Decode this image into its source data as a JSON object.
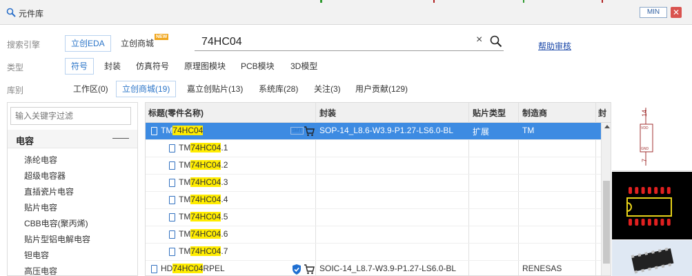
{
  "window": {
    "title": "元件库",
    "min_label": "MIN",
    "close_label": "✕"
  },
  "search_row": {
    "label": "搜索引擎",
    "engines": [
      "立创EDA",
      "立创商城"
    ],
    "new_badge": "NEW",
    "query": "74HC04",
    "help_link": "帮助审核"
  },
  "type_row": {
    "label": "类型",
    "types": [
      "符号",
      "封装",
      "仿真符号",
      "原理图模块",
      "PCB模块",
      "3D模型"
    ]
  },
  "lib_row": {
    "label": "库别",
    "libs": [
      "工作区(0)",
      "立创商城(19)",
      "嘉立创贴片(13)",
      "系统库(28)",
      "关注(3)",
      "用户贡献(129)"
    ]
  },
  "left_panel": {
    "filter_placeholder": "输入关键字过滤",
    "category": "电容",
    "items": [
      "涤纶电容",
      "超级电容器",
      "直插瓷片电容",
      "贴片电容",
      "CBB电容(聚丙烯)",
      "贴片型铝电解电容",
      "钽电容",
      "高压电容"
    ]
  },
  "table": {
    "headers": [
      "标题(零件名称)",
      "封装",
      "贴片类型",
      "制造商",
      "封"
    ],
    "rows": [
      {
        "prefix": "TM",
        "hl": "74HC04",
        "suffix": "",
        "badge": "SMT",
        "package": "SOP-14_L8.6-W3.9-P1.27-LS6.0-BL",
        "smt_type": "扩展",
        "maker": "TM",
        "selected": true
      },
      {
        "prefix": "TM",
        "hl": "74HC04",
        "suffix": ".1",
        "package": "",
        "smt_type": "",
        "maker": ""
      },
      {
        "prefix": "TM",
        "hl": "74HC04",
        "suffix": ".2",
        "package": "",
        "smt_type": "",
        "maker": ""
      },
      {
        "prefix": "TM",
        "hl": "74HC04",
        "suffix": ".3",
        "package": "",
        "smt_type": "",
        "maker": ""
      },
      {
        "prefix": "TM",
        "hl": "74HC04",
        "suffix": ".4",
        "package": "",
        "smt_type": "",
        "maker": ""
      },
      {
        "prefix": "TM",
        "hl": "74HC04",
        "suffix": ".5",
        "package": "",
        "smt_type": "",
        "maker": ""
      },
      {
        "prefix": "TM",
        "hl": "74HC04",
        "suffix": ".6",
        "package": "",
        "smt_type": "",
        "maker": ""
      },
      {
        "prefix": "TM",
        "hl": "74HC04",
        "suffix": ".7",
        "package": "",
        "smt_type": "",
        "maker": ""
      },
      {
        "prefix": "HD",
        "hl": "74HC04",
        "suffix": "RPEL",
        "package": "SOIC-14_L8.7-W3.9-P1.27-LS6.0-BL",
        "smt_type": "",
        "maker": "RENESAS"
      }
    ]
  },
  "preview": {
    "pin_top": "14",
    "pin_bottom": "7",
    "vdd": "VDD",
    "gnd": "GND"
  },
  "colors": {
    "selected_row": "#3d8be2",
    "highlight": "#ffec00",
    "link": "#1a47a8",
    "pad": "#e02020"
  }
}
